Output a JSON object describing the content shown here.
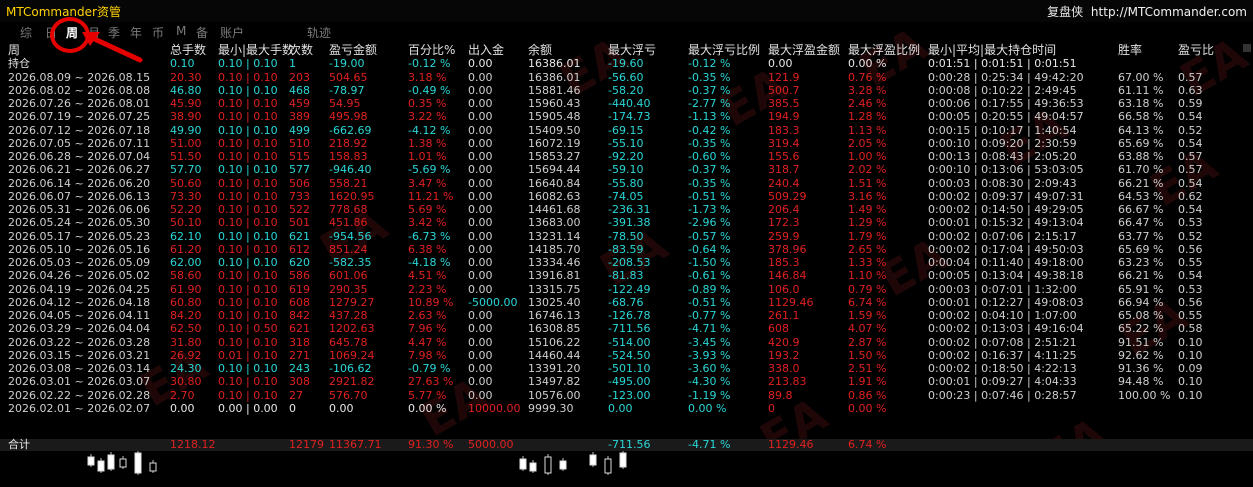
{
  "window": {
    "title": "MTCommander资管",
    "brand": "复盘侠",
    "site": "http://MTCommander.com"
  },
  "tabs": [
    "综",
    "日",
    "周",
    "月",
    "季",
    "年",
    "币",
    "M",
    "备",
    "账户",
    "轨迹"
  ],
  "active_tab": "周",
  "headers": [
    "周",
    "总手数",
    "最小|最大手数",
    "次数",
    "盈亏金额",
    "百分比%",
    "出入金",
    "余额",
    "最大浮亏",
    "最大浮亏比例",
    "最大浮盈金额",
    "最大浮盈比例",
    "最小|平均|最大持仓时间",
    "胜率",
    "盈亏比"
  ],
  "holding": {
    "label": "持仓",
    "lots": "0.10",
    "min_max": "0.10 | 0.10",
    "count": "1",
    "pnl": "-19.00",
    "pct": "-0.12 %",
    "deposit": "0.00",
    "balance": "16386.01",
    "max_float_loss": "-19.60",
    "max_float_loss_pct": "-0.12 %",
    "max_float_profit": "0.00",
    "max_float_profit_pct": "0.00 %",
    "hold_time": "0:01:51 | 0:01:51 | 0:01:51"
  },
  "rows": [
    [
      "2026.08.09 ~ 2026.08.15",
      "20.30",
      "0.10 | 0.10",
      "203",
      "504.65",
      "3.18 %",
      "0.00",
      "16386.01",
      "-56.60",
      "-0.35 %",
      "121.9",
      "0.76 %",
      "0:00:28 | 0:25:34 | 49:42:20",
      "67.00 %",
      "0.57"
    ],
    [
      "2026.08.02 ~ 2026.08.08",
      "46.80",
      "0.10 | 0.10",
      "468",
      "-78.97",
      "-0.49 %",
      "0.00",
      "15881.46",
      "-58.20",
      "-0.37 %",
      "500.7",
      "3.28 %",
      "0:00:08 | 0:10:22 | 2:49:45",
      "61.11 %",
      "0.63"
    ],
    [
      "2026.07.26 ~ 2026.08.01",
      "45.90",
      "0.10 | 0.10",
      "459",
      "54.95",
      "0.35 %",
      "0.00",
      "15960.43",
      "-440.40",
      "-2.77 %",
      "385.5",
      "2.46 %",
      "0:00:06 | 0:17:55 | 49:36:53",
      "63.18 %",
      "0.59"
    ],
    [
      "2026.07.19 ~ 2026.07.25",
      "38.90",
      "0.10 | 0.10",
      "389",
      "495.98",
      "3.22 %",
      "0.00",
      "15905.48",
      "-174.73",
      "-1.13 %",
      "194.9",
      "1.28 %",
      "0:00:05 | 0:20:55 | 49:04:57",
      "66.58 %",
      "0.54"
    ],
    [
      "2026.07.12 ~ 2026.07.18",
      "49.90",
      "0.10 | 0.10",
      "499",
      "-662.69",
      "-4.12 %",
      "0.00",
      "15409.50",
      "-69.15",
      "-0.42 %",
      "183.3",
      "1.13 %",
      "0:00:15 | 0:10:17 | 1:40:54",
      "64.13 %",
      "0.52"
    ],
    [
      "2026.07.05 ~ 2026.07.11",
      "51.00",
      "0.10 | 0.10",
      "510",
      "218.92",
      "1.38 %",
      "0.00",
      "16072.19",
      "-55.10",
      "-0.35 %",
      "319.4",
      "2.05 %",
      "0:00:10 | 0:09:20 | 2:30:59",
      "65.69 %",
      "0.54"
    ],
    [
      "2026.06.28 ~ 2026.07.04",
      "51.50",
      "0.10 | 0.10",
      "515",
      "158.83",
      "1.01 %",
      "0.00",
      "15853.27",
      "-92.20",
      "-0.60 %",
      "155.6",
      "1.00 %",
      "0:00:13 | 0:08:43 | 2:05:20",
      "63.88 %",
      "0.57"
    ],
    [
      "2026.06.21 ~ 2026.06.27",
      "57.70",
      "0.10 | 0.10",
      "577",
      "-946.40",
      "-5.69 %",
      "0.00",
      "15694.44",
      "-59.10",
      "-0.37 %",
      "318.7",
      "2.02 %",
      "0:00:10 | 0:13:06 | 53:03:05",
      "61.70 %",
      "0.57"
    ],
    [
      "2026.06.14 ~ 2026.06.20",
      "50.60",
      "0.10 | 0.10",
      "506",
      "558.21",
      "3.47 %",
      "0.00",
      "16640.84",
      "-55.80",
      "-0.35 %",
      "240.4",
      "1.51 %",
      "0:00:03 | 0:08:30 | 2:09:43",
      "66.21 %",
      "0.54"
    ],
    [
      "2026.06.07 ~ 2026.06.13",
      "73.30",
      "0.10 | 0.10",
      "733",
      "1620.95",
      "11.21 %",
      "0.00",
      "16082.63",
      "-74.05",
      "-0.51 %",
      "509.29",
      "3.16 %",
      "0:00:02 | 0:09:37 | 49:07:31",
      "64.53 %",
      "0.62"
    ],
    [
      "2026.05.31 ~ 2026.06.06",
      "52.20",
      "0.10 | 0.10",
      "522",
      "778.68",
      "5.69 %",
      "0.00",
      "14461.68",
      "-236.31",
      "-1.73 %",
      "206.4",
      "1.49 %",
      "0:00:02 | 0:14:50 | 49:29:05",
      "66.67 %",
      "0.54"
    ],
    [
      "2026.05.24 ~ 2026.05.30",
      "50.10",
      "0.10 | 0.10",
      "501",
      "451.86",
      "3.42 %",
      "0.00",
      "13683.00",
      "-391.38",
      "-2.96 %",
      "172.3",
      "1.29 %",
      "0:00:01 | 0:15:32 | 49:13:04",
      "66.47 %",
      "0.53"
    ],
    [
      "2026.05.17 ~ 2026.05.23",
      "62.10",
      "0.10 | 0.10",
      "621",
      "-954.56",
      "-6.73 %",
      "0.00",
      "13231.14",
      "-78.50",
      "-0.57 %",
      "259.9",
      "1.79 %",
      "0:00:02 | 0:07:06 | 2:15:17",
      "63.77 %",
      "0.52"
    ],
    [
      "2026.05.10 ~ 2026.05.16",
      "61.20",
      "0.10 | 0.10",
      "612",
      "851.24",
      "6.38 %",
      "0.00",
      "14185.70",
      "-83.59",
      "-0.64 %",
      "378.96",
      "2.65 %",
      "0:00:02 | 0:17:04 | 49:50:03",
      "65.69 %",
      "0.56"
    ],
    [
      "2026.05.03 ~ 2026.05.09",
      "62.00",
      "0.10 | 0.10",
      "620",
      "-582.35",
      "-4.18 %",
      "0.00",
      "13334.46",
      "-208.53",
      "-1.50 %",
      "185.3",
      "1.33 %",
      "0:00:04 | 0:11:40 | 49:18:00",
      "63.23 %",
      "0.55"
    ],
    [
      "2026.04.26 ~ 2026.05.02",
      "58.60",
      "0.10 | 0.10",
      "586",
      "601.06",
      "4.51 %",
      "0.00",
      "13916.81",
      "-81.83",
      "-0.61 %",
      "146.84",
      "1.10 %",
      "0:00:05 | 0:13:04 | 49:38:18",
      "66.21 %",
      "0.54"
    ],
    [
      "2026.04.19 ~ 2026.04.25",
      "61.90",
      "0.10 | 0.10",
      "619",
      "290.35",
      "2.23 %",
      "0.00",
      "13315.75",
      "-122.49",
      "-0.89 %",
      "106.0",
      "0.79 %",
      "0:00:03 | 0:07:01 | 1:32:00",
      "65.91 %",
      "0.53"
    ],
    [
      "2026.04.12 ~ 2026.04.18",
      "60.80",
      "0.10 | 0.10",
      "608",
      "1279.27",
      "10.89 %",
      "-5000.00",
      "13025.40",
      "-68.76",
      "-0.51 %",
      "1129.46",
      "6.74 %",
      "0:00:01 | 0:12:27 | 49:08:03",
      "66.94 %",
      "0.56"
    ],
    [
      "2026.04.05 ~ 2026.04.11",
      "84.20",
      "0.10 | 0.10",
      "842",
      "437.28",
      "2.63 %",
      "0.00",
      "16746.13",
      "-126.78",
      "-0.77 %",
      "261.1",
      "1.59 %",
      "0:00:02 | 0:04:10 | 1:07:00",
      "65.08 %",
      "0.55"
    ],
    [
      "2026.03.29 ~ 2026.04.04",
      "62.50",
      "0.10 | 0.50",
      "621",
      "1202.63",
      "7.96 %",
      "0.00",
      "16308.85",
      "-711.56",
      "-4.71 %",
      "608",
      "4.07 %",
      "0:00:02 | 0:13:03 | 49:16:04",
      "65.22 %",
      "0.58"
    ],
    [
      "2026.03.22 ~ 2026.03.28",
      "31.80",
      "0.10 | 0.10",
      "318",
      "645.78",
      "4.47 %",
      "0.00",
      "15106.22",
      "-514.00",
      "-3.45 %",
      "420.9",
      "2.87 %",
      "0:00:02 | 0:07:08 | 2:51:21",
      "91.51 %",
      "0.10"
    ],
    [
      "2026.03.15 ~ 2026.03.21",
      "26.92",
      "0.01 | 0.10",
      "271",
      "1069.24",
      "7.98 %",
      "0.00",
      "14460.44",
      "-524.50",
      "-3.93 %",
      "193.2",
      "1.50 %",
      "0:00:02 | 0:16:37 | 4:11:25",
      "92.62 %",
      "0.10"
    ],
    [
      "2026.03.08 ~ 2026.03.14",
      "24.30",
      "0.10 | 0.10",
      "243",
      "-106.62",
      "-0.79 %",
      "0.00",
      "13391.20",
      "-501.10",
      "-3.60 %",
      "338.0",
      "2.51 %",
      "0:00:02 | 0:18:50 | 4:22:13",
      "91.36 %",
      "0.09"
    ],
    [
      "2026.03.01 ~ 2026.03.07",
      "30.80",
      "0.10 | 0.10",
      "308",
      "2921.82",
      "27.63 %",
      "0.00",
      "13497.82",
      "-495.00",
      "-4.30 %",
      "213.83",
      "1.91 %",
      "0:00:01 | 0:09:27 | 4:04:33",
      "94.48 %",
      "0.10"
    ],
    [
      "2026.02.22 ~ 2026.02.28",
      "2.70",
      "0.10 | 0.10",
      "27",
      "576.70",
      "5.77 %",
      "0.00",
      "10576.00",
      "-123.00",
      "-1.19 %",
      "89.8",
      "0.86 %",
      "0:00:23 | 0:07:46 | 0:28:57",
      "100.00 %",
      "0.10"
    ],
    [
      "2026.02.01 ~ 2026.02.07",
      "0.00",
      "0.00 | 0.00",
      "0",
      "0.00",
      "0.00 %",
      "10000.00",
      "9999.30",
      "0.00",
      "0.00 %",
      "0",
      "0.00 %",
      "",
      "",
      ""
    ]
  ],
  "total": {
    "label": "合计",
    "lots": "1218.12",
    "count": "12179",
    "pnl": "11367.71",
    "pct": "91.30 %",
    "deposit": "5000.00",
    "max_float_loss": "-711.56",
    "max_float_loss_pct": "-4.71 %",
    "max_float_profit": "1129.46",
    "max_float_profit_pct": "6.74 %"
  },
  "watermark": "EA"
}
